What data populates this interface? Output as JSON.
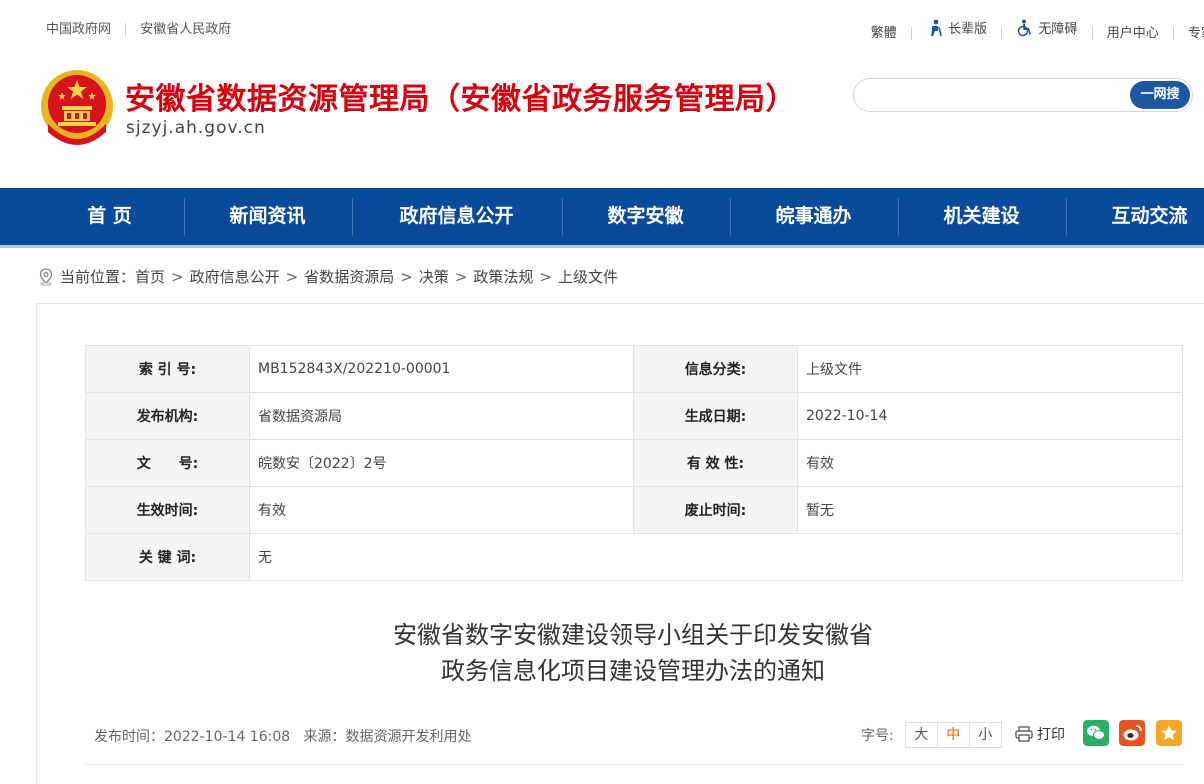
{
  "topbar": {
    "links_left": [
      "中国政府网",
      "安徽省人民政府"
    ],
    "traditional": "繁體",
    "elder": "长辈版",
    "accessibility": "无障碍",
    "user_center": "用户中心",
    "expert": "专家"
  },
  "header": {
    "title": "安徽省数据资源管理局（安徽省政务服务管理局）",
    "url": "sjzyj.ah.gov.cn",
    "search_placeholder": "",
    "search_button": "一网搜"
  },
  "nav": [
    "首 页",
    "新闻资讯",
    "政府信息公开",
    "数字安徽",
    "皖事通办",
    "机关建设",
    "互动交流"
  ],
  "breadcrumb": {
    "prefix": "当前位置：",
    "items": [
      "首页",
      "政府信息公开",
      "省数据资源局",
      "决策",
      "政策法规",
      "上级文件"
    ]
  },
  "meta": {
    "index_label": "索 引 号:",
    "index_value": "MB152843X/202210-00001",
    "category_label": "信息分类:",
    "category_value": "上级文件",
    "publisher_label": "发布机构:",
    "publisher_value": "省数据资源局",
    "date_label": "生成日期:",
    "date_value": "2022-10-14",
    "docno_label": "文　　号:",
    "docno_value": "皖数安〔2022〕2号",
    "validity_label": "有 效 性:",
    "validity_value": "有效",
    "effective_label": "生效时间:",
    "effective_value": "有效",
    "expire_label": "废止时间:",
    "expire_value": "暂无",
    "keywords_label": "关 键 词:",
    "keywords_value": "无"
  },
  "document": {
    "title_line1": "安徽省数字安徽建设领导小组关于印发安徽省",
    "title_line2": "政务信息化项目建设管理办法的通知",
    "publish_time": "发布时间：2022-10-14 16:08",
    "source": "来源：数据资源开发利用处",
    "font_label": "字号:",
    "font_sizes": [
      "大",
      "中",
      "小"
    ],
    "print": "打印"
  },
  "colors": {
    "nav_bg": "#0a4a9a",
    "title_red": "#d7000f",
    "search_btn": "#1e56a0",
    "wechat": "#2aae67",
    "weibo": "#e8541e",
    "favorite": "#f5a623"
  }
}
